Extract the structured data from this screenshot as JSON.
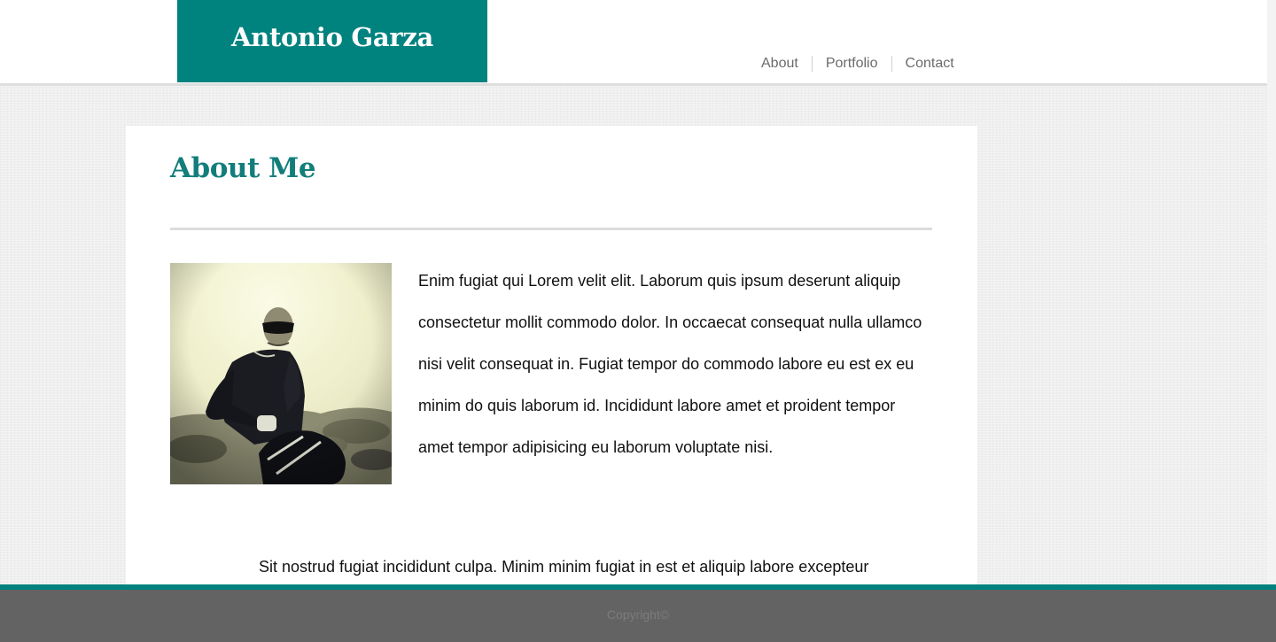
{
  "header": {
    "logo_text": "Antonio Garza",
    "nav": [
      {
        "label": "About"
      },
      {
        "label": "Portfolio"
      },
      {
        "label": "Contact"
      }
    ]
  },
  "main": {
    "title": "About Me",
    "paragraph_1": "Enim fugiat qui Lorem velit elit. Laborum quis ipsum deserunt aliquip consectetur mollit commodo dolor. In occaecat consequat nulla ullamco nisi velit consequat in. Fugiat tempor do commodo labore eu est ex eu minim do quis laborum id. Incididunt labore amet et proident tempor amet tempor adipisicing eu laborum voluptate nisi.",
    "paragraph_2": "Sit nostrud fugiat incididunt culpa. Minim minim fugiat in est et aliquip labore excepteur"
  },
  "footer": {
    "copyright": "Copyright©"
  },
  "colors": {
    "accent": "#00827f",
    "title": "#127d7b",
    "footer_bg": "#636363",
    "nav_text": "#6b6b6b"
  }
}
